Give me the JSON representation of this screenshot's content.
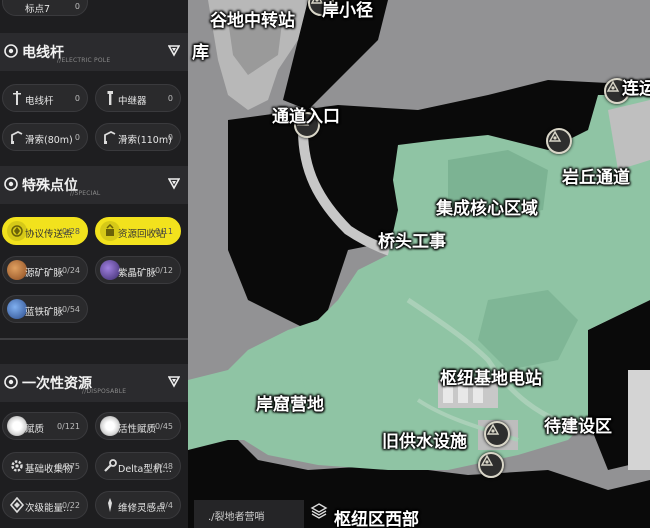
{
  "sidebar": {
    "top_item": {
      "label": "标点7",
      "count": "0"
    },
    "sections": [
      {
        "title": "电线杆",
        "subtitle": "//ELECTRIC POLE",
        "items": [
          {
            "label": "电线杆",
            "count": "0",
            "icon": "pole-icon",
            "highlighted": false
          },
          {
            "label": "中继器",
            "count": "0",
            "icon": "relay-icon",
            "highlighted": false
          },
          {
            "label": "滑索(80m)",
            "count": "0",
            "icon": "zipline-icon",
            "highlighted": false
          },
          {
            "label": "滑索(110m)",
            "count": "0",
            "icon": "zipline-icon",
            "highlighted": false
          }
        ]
      },
      {
        "title": "特殊点位",
        "subtitle": "//SPECIAL",
        "items": [
          {
            "label": "协议传送点",
            "count": "0/28",
            "icon": "teleport-icon",
            "highlighted": true
          },
          {
            "label": "资源回收站",
            "count": "0/11",
            "icon": "recycle-icon",
            "highlighted": true
          },
          {
            "label": "源矿矿脉",
            "count": "0/24",
            "icon": "ore-icon",
            "highlighted": false
          },
          {
            "label": "紫晶矿脉",
            "count": "0/12",
            "icon": "amethyst-icon",
            "highlighted": false
          },
          {
            "label": "蓝铁矿脉",
            "count": "0/54",
            "icon": "blue-iron-icon",
            "highlighted": false
          }
        ]
      },
      {
        "title": "一次性资源",
        "subtitle": "//DISPOSABLE",
        "items": [
          {
            "label": "赋质",
            "count": "0/121",
            "icon": "orb-icon",
            "highlighted": false
          },
          {
            "label": "活性赋质",
            "count": "0/45",
            "icon": "orb-icon",
            "highlighted": false
          },
          {
            "label": "基础收集物",
            "count": "0/275",
            "icon": "gear-icon",
            "highlighted": false
          },
          {
            "label": "Delta型机…",
            "count": "0/48",
            "icon": "wrench-icon",
            "highlighted": false
          },
          {
            "label": "次级能量…",
            "count": "0/22",
            "icon": "energy-icon",
            "highlighted": false
          },
          {
            "label": "维修灵感点",
            "count": "0/4",
            "icon": "inspiration-icon",
            "highlighted": false
          }
        ]
      }
    ]
  },
  "map": {
    "labels": [
      "谷地中转站",
      "岸小径",
      "库",
      "通道入口",
      "岩丘通道",
      "集成核心区域",
      "桥头工事",
      "枢纽基地电站",
      "岸窟营地",
      "旧供水设施",
      "待建设区",
      "枢纽区西部",
      "连运"
    ],
    "current_location": "./裂地者营哨",
    "colors": {
      "land": "#8fc4a4",
      "void": "#0a0a0a",
      "background": "#929294",
      "highlight": "#f2e21d"
    }
  }
}
